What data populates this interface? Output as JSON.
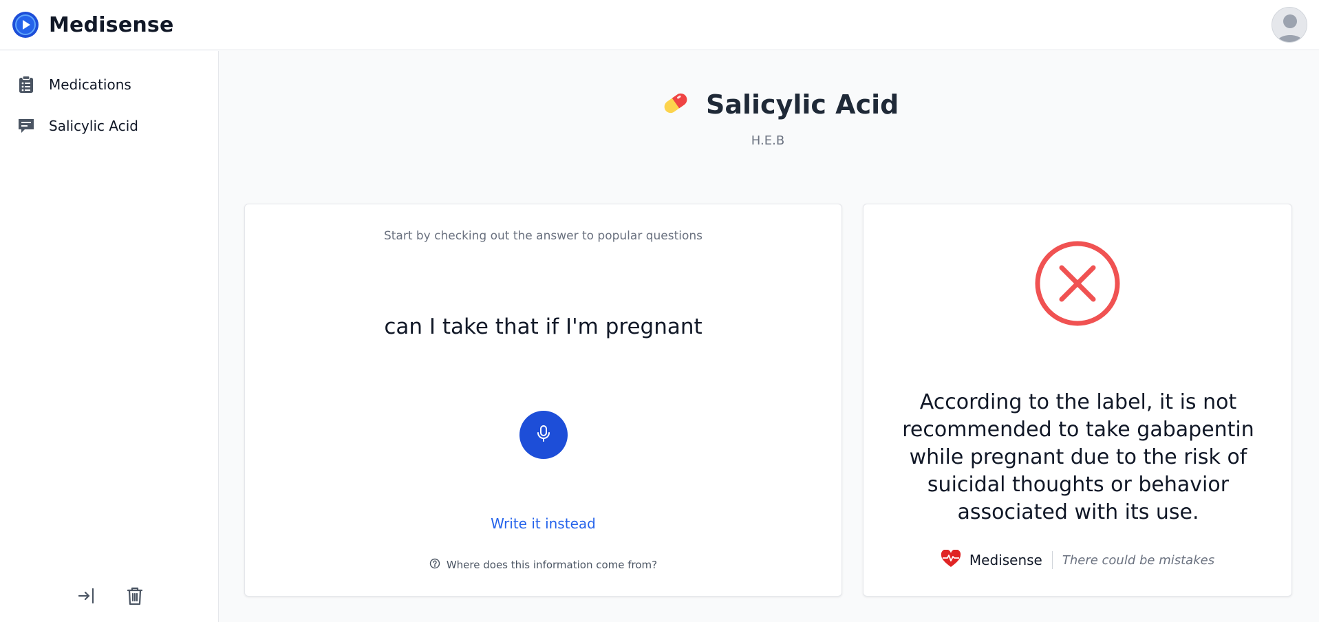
{
  "app": {
    "brand": "Medisense",
    "logo_icon": "play-logo-icon",
    "avatar_icon": "user-avatar-icon"
  },
  "sidebar": {
    "items": [
      {
        "label": "Medications",
        "icon": "clipboard-list-icon"
      },
      {
        "label": "Salicylic Acid",
        "icon": "chat-bubble-icon"
      }
    ],
    "actions": [
      {
        "icon": "login-arrow-icon"
      },
      {
        "icon": "trash-icon"
      }
    ]
  },
  "medication": {
    "name": "Salicylic Acid",
    "manufacturer": "H.E.B",
    "icon": "pill-icon"
  },
  "question_card": {
    "hint": "Start by checking out the answer to popular questions",
    "question": "can I take that if I'm pregnant",
    "mic_icon": "microphone-icon",
    "write_label": "Write it instead",
    "source_label": "Where does this information come from?"
  },
  "answer_card": {
    "status_icon": "x-circle-icon",
    "answer": "According to the label, it is not recommended to take gabapentin while pregnant due to the risk of suicidal thoughts or behavior associated with its use.",
    "footer_brand": "Medisense",
    "disclaimer": "There could be mistakes"
  },
  "colors": {
    "primary": "#1d4ed8",
    "link": "#2563eb",
    "error": "#f05252",
    "background": "#f9fafb"
  }
}
